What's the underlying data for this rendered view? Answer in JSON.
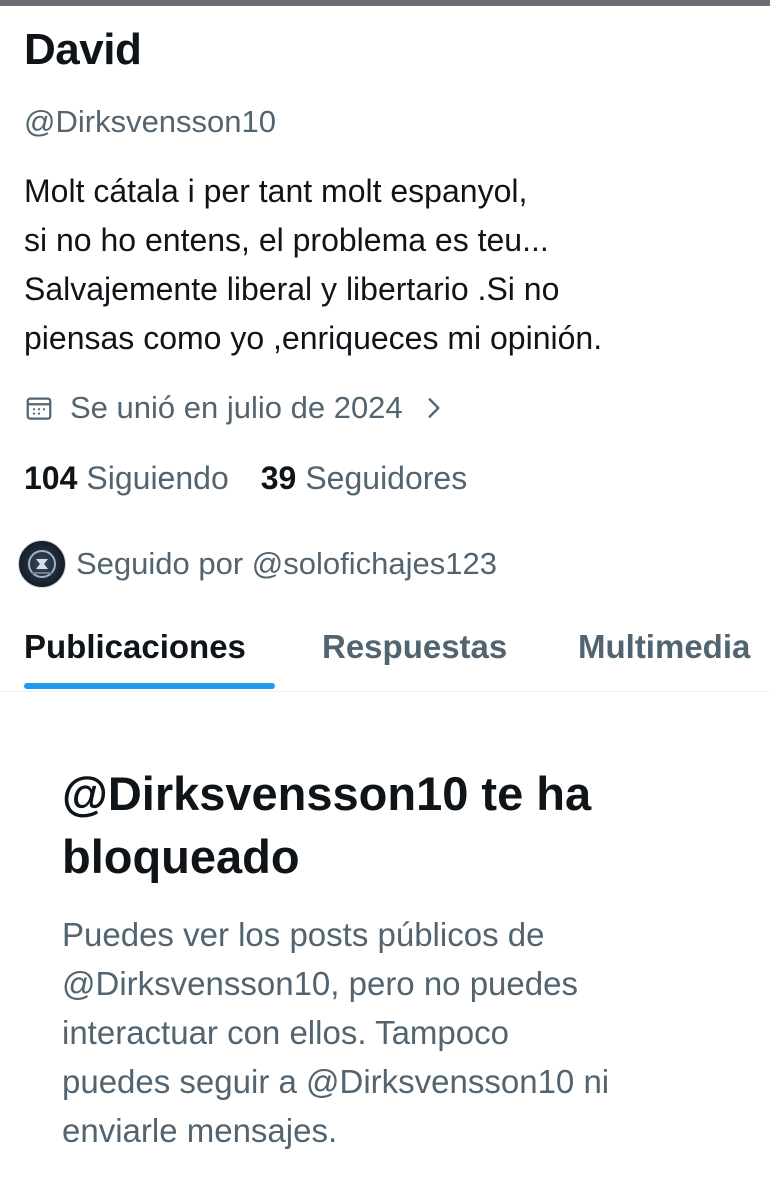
{
  "profile": {
    "display_name": "David",
    "handle": "@Dirksvensson10",
    "bio_lines": [
      "Molt cátala i per tant molt espanyol,",
      "si no ho entens, el problema es teu...",
      "Salvajemente liberal y libertario .Si no",
      "piensas como yo ,enriqueces mi opinión."
    ],
    "joined": {
      "icon": "calendar-icon",
      "text": "Se unió en julio de 2024",
      "chevron_icon": "chevron-right-icon"
    },
    "following": {
      "count": "104",
      "label": "Siguiendo"
    },
    "followers": {
      "count": "39",
      "label": "Seguidores"
    },
    "followed_by": {
      "text": "Seguido por @solofichajes123"
    }
  },
  "tabs": [
    {
      "label": "Publicaciones",
      "active": true
    },
    {
      "label": "Respuestas",
      "active": false
    },
    {
      "label": "Multimedia",
      "active": false
    }
  ],
  "blocked": {
    "title_lines": [
      "@Dirksvensson10 te ha",
      "bloqueado"
    ],
    "description_lines": [
      "Puedes ver los posts públicos de",
      "@Dirksvensson10, pero no puedes",
      "interactuar con ellos. Tampoco",
      "puedes seguir a @Dirksvensson10 ni",
      "enviarle mensajes."
    ]
  },
  "colors": {
    "text_primary": "#0f1419",
    "text_secondary": "#536471",
    "accent": "#1d9bf0",
    "divider": "#eff3f4"
  }
}
